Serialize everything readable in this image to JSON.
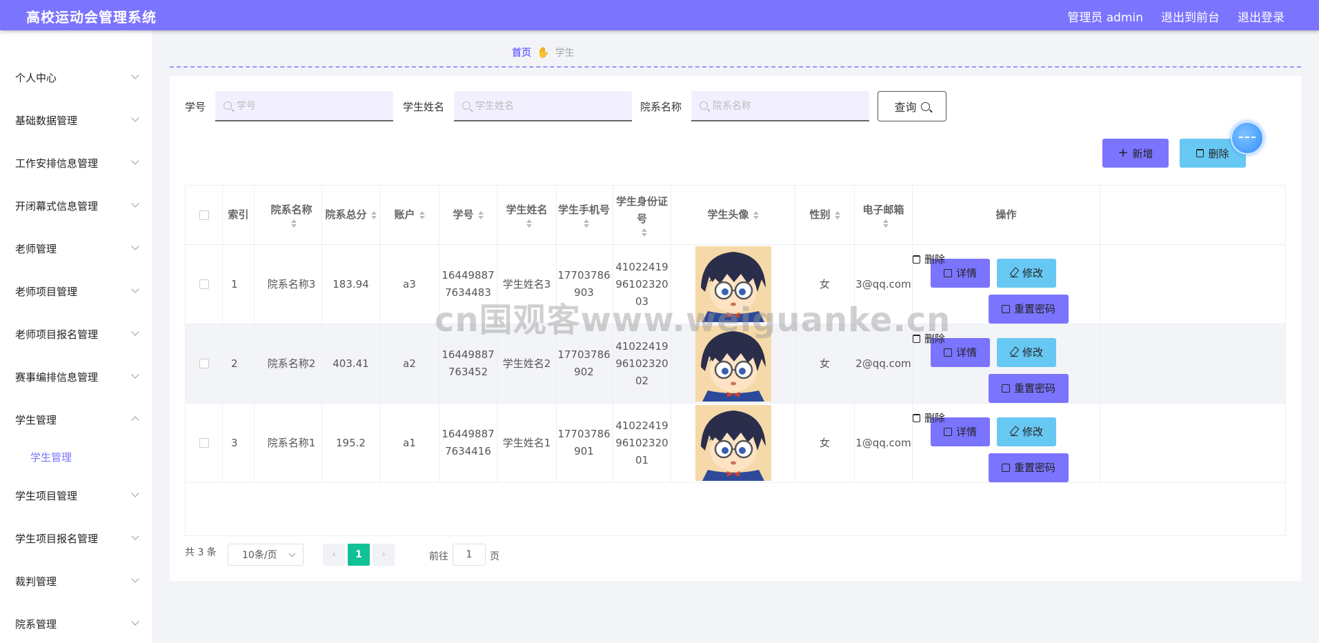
{
  "header": {
    "title": "高校运动会管理系统",
    "admin_label": "管理员 admin",
    "to_front": "退出到前台",
    "logout": "退出登录"
  },
  "sidebar": {
    "items": [
      {
        "label": "个人中心"
      },
      {
        "label": "基础数据管理"
      },
      {
        "label": "工作安排信息管理"
      },
      {
        "label": "开闭幕式信息管理"
      },
      {
        "label": "老师管理"
      },
      {
        "label": "老师项目管理"
      },
      {
        "label": "老师项目报名管理"
      },
      {
        "label": "赛事编排信息管理"
      },
      {
        "label": "学生管理",
        "expanded": true,
        "sub": "学生管理"
      },
      {
        "label": "学生项目管理"
      },
      {
        "label": "学生项目报名管理"
      },
      {
        "label": "裁判管理"
      },
      {
        "label": "院系管理"
      }
    ]
  },
  "breadcrumb": {
    "home": "首页",
    "current": "学生"
  },
  "search": {
    "fields": [
      {
        "label": "学号",
        "placeholder": "学号"
      },
      {
        "label": "学生姓名",
        "placeholder": "学生姓名"
      },
      {
        "label": "院系名称",
        "placeholder": "院系名称"
      }
    ],
    "query_label": "查询"
  },
  "toolbar": {
    "add_label": "新增",
    "delete_label": "删除"
  },
  "table": {
    "headers": [
      "索引",
      "院系名称",
      "院系总分",
      "账户",
      "学号",
      "学生姓名",
      "学生手机号",
      "学生身份证号",
      "学生头像",
      "性别",
      "电子邮箱",
      "操作"
    ],
    "rows": [
      {
        "index": "1",
        "dept": "院系名称3",
        "score": "183.94",
        "account": "a3",
        "sid": [
          "16449887",
          "7634483"
        ],
        "name": "学生姓名3",
        "phone": [
          "17703786",
          "903"
        ],
        "idcard": [
          "41022419",
          "96102320",
          "03"
        ],
        "gender": "女",
        "email": "3@qq.com"
      },
      {
        "index": "2",
        "dept": "院系名称2",
        "score": "403.41",
        "account": "a2",
        "sid": [
          "16449887",
          "763452"
        ],
        "name": "学生姓名2",
        "phone": [
          "17703786",
          "902"
        ],
        "idcard": [
          "41022419",
          "96102320",
          "02"
        ],
        "gender": "女",
        "email": "2@qq.com"
      },
      {
        "index": "3",
        "dept": "院系名称1",
        "score": "195.2",
        "account": "a1",
        "sid": [
          "16449887",
          "7634416"
        ],
        "name": "学生姓名1",
        "phone": [
          "17703786",
          "901"
        ],
        "idcard": [
          "41022419",
          "96102320",
          "01"
        ],
        "gender": "女",
        "email": "1@qq.com"
      }
    ],
    "actions": {
      "detail": "详情",
      "edit": "修改",
      "delete": "删除",
      "reset": "重置密码"
    }
  },
  "pagination": {
    "total": "共 3 条",
    "page_size": "10条/页",
    "current": "1",
    "goto_prefix": "前往",
    "goto_value": "1",
    "goto_suffix": "页"
  },
  "watermark": "cn国观客www.weiguanke.cn",
  "colors": {
    "primary": "#7b74ff",
    "info": "#67c8f3",
    "warn": "#d4f55c",
    "pager_active": "#11c196"
  }
}
